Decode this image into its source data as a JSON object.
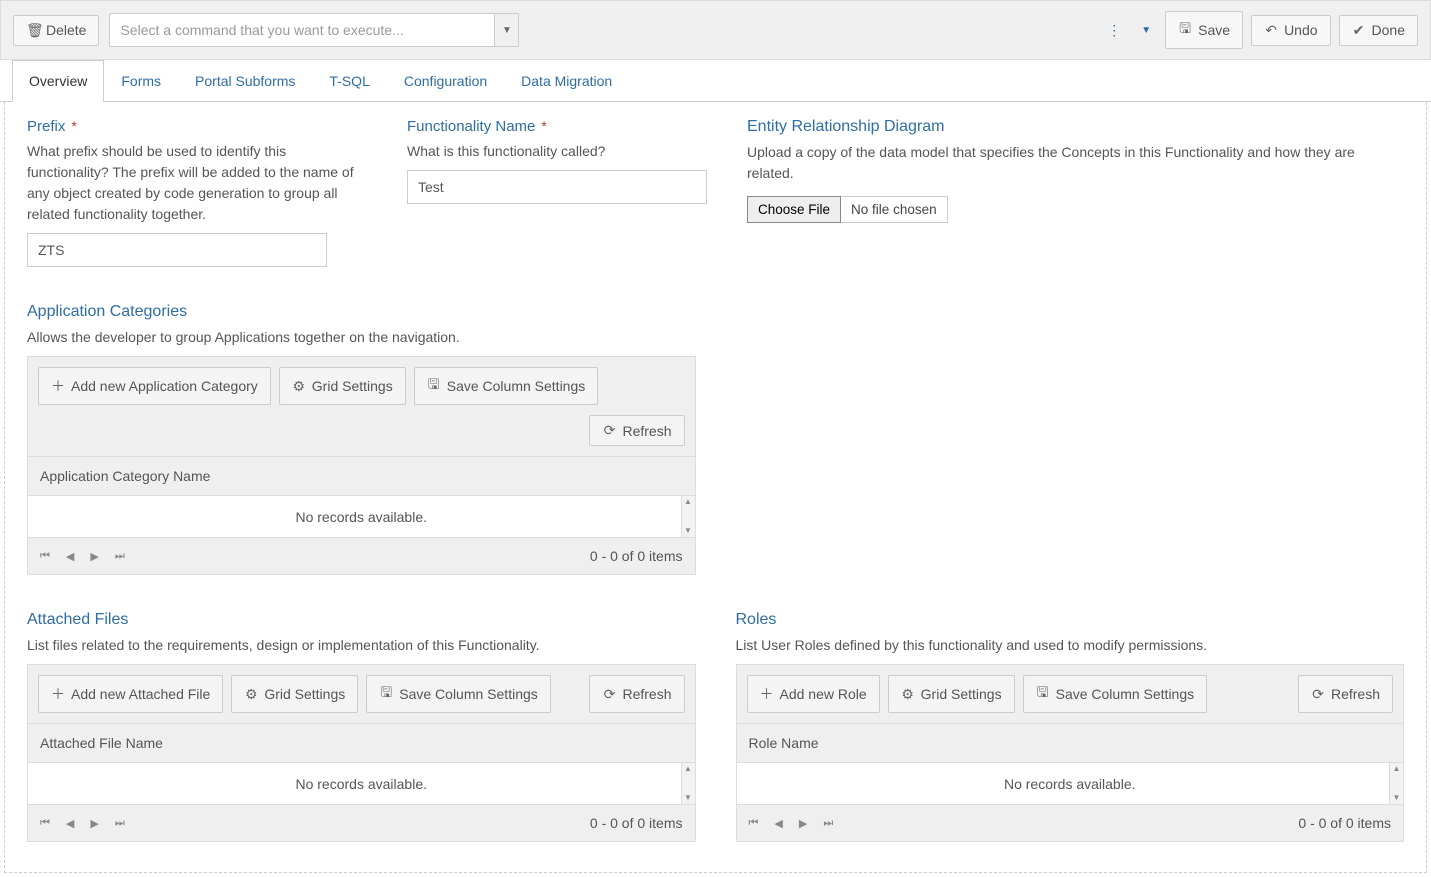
{
  "toolbar": {
    "delete_label": "Delete",
    "command_placeholder": "Select a command that you want to execute...",
    "save_label": "Save",
    "undo_label": "Undo",
    "done_label": "Done"
  },
  "tabs": {
    "overview": "Overview",
    "forms": "Forms",
    "portal_subforms": "Portal Subforms",
    "tsql": "T-SQL",
    "configuration": "Configuration",
    "data_migration": "Data Migration"
  },
  "prefix": {
    "title": "Prefix",
    "hint": "What prefix should be used to identify this functionality? The prefix will be added to the name of any object created by code generation to group all related functionality together.",
    "value": "ZTS"
  },
  "functionality_name": {
    "title": "Functionality Name",
    "hint": "What is this functionality called?",
    "value": "Test"
  },
  "erd": {
    "title": "Entity Relationship Diagram",
    "hint": "Upload a copy of the data model that specifies the Concepts in this Functionality and how they are related.",
    "choose_file_label": "Choose File",
    "no_file_label": "No file chosen"
  },
  "grids": {
    "app_categories": {
      "title": "Application Categories",
      "hint": "Allows the developer to group Applications together on the navigation.",
      "add_label": "Add new Application Category",
      "column": "Application Category Name"
    },
    "attached_files": {
      "title": "Attached Files",
      "hint": "List files related to the requirements, design or implementation of this Functionality.",
      "add_label": "Add new Attached File",
      "column": "Attached File Name"
    },
    "roles": {
      "title": "Roles",
      "hint": "List User Roles defined by this functionality and used to modify permissions.",
      "add_label": "Add new Role",
      "column": "Role Name"
    },
    "shared": {
      "grid_settings_label": "Grid Settings",
      "save_cols_label": "Save Column Settings",
      "refresh_label": "Refresh",
      "no_records": "No records available.",
      "page_count": "0 - 0 of 0 items"
    }
  }
}
